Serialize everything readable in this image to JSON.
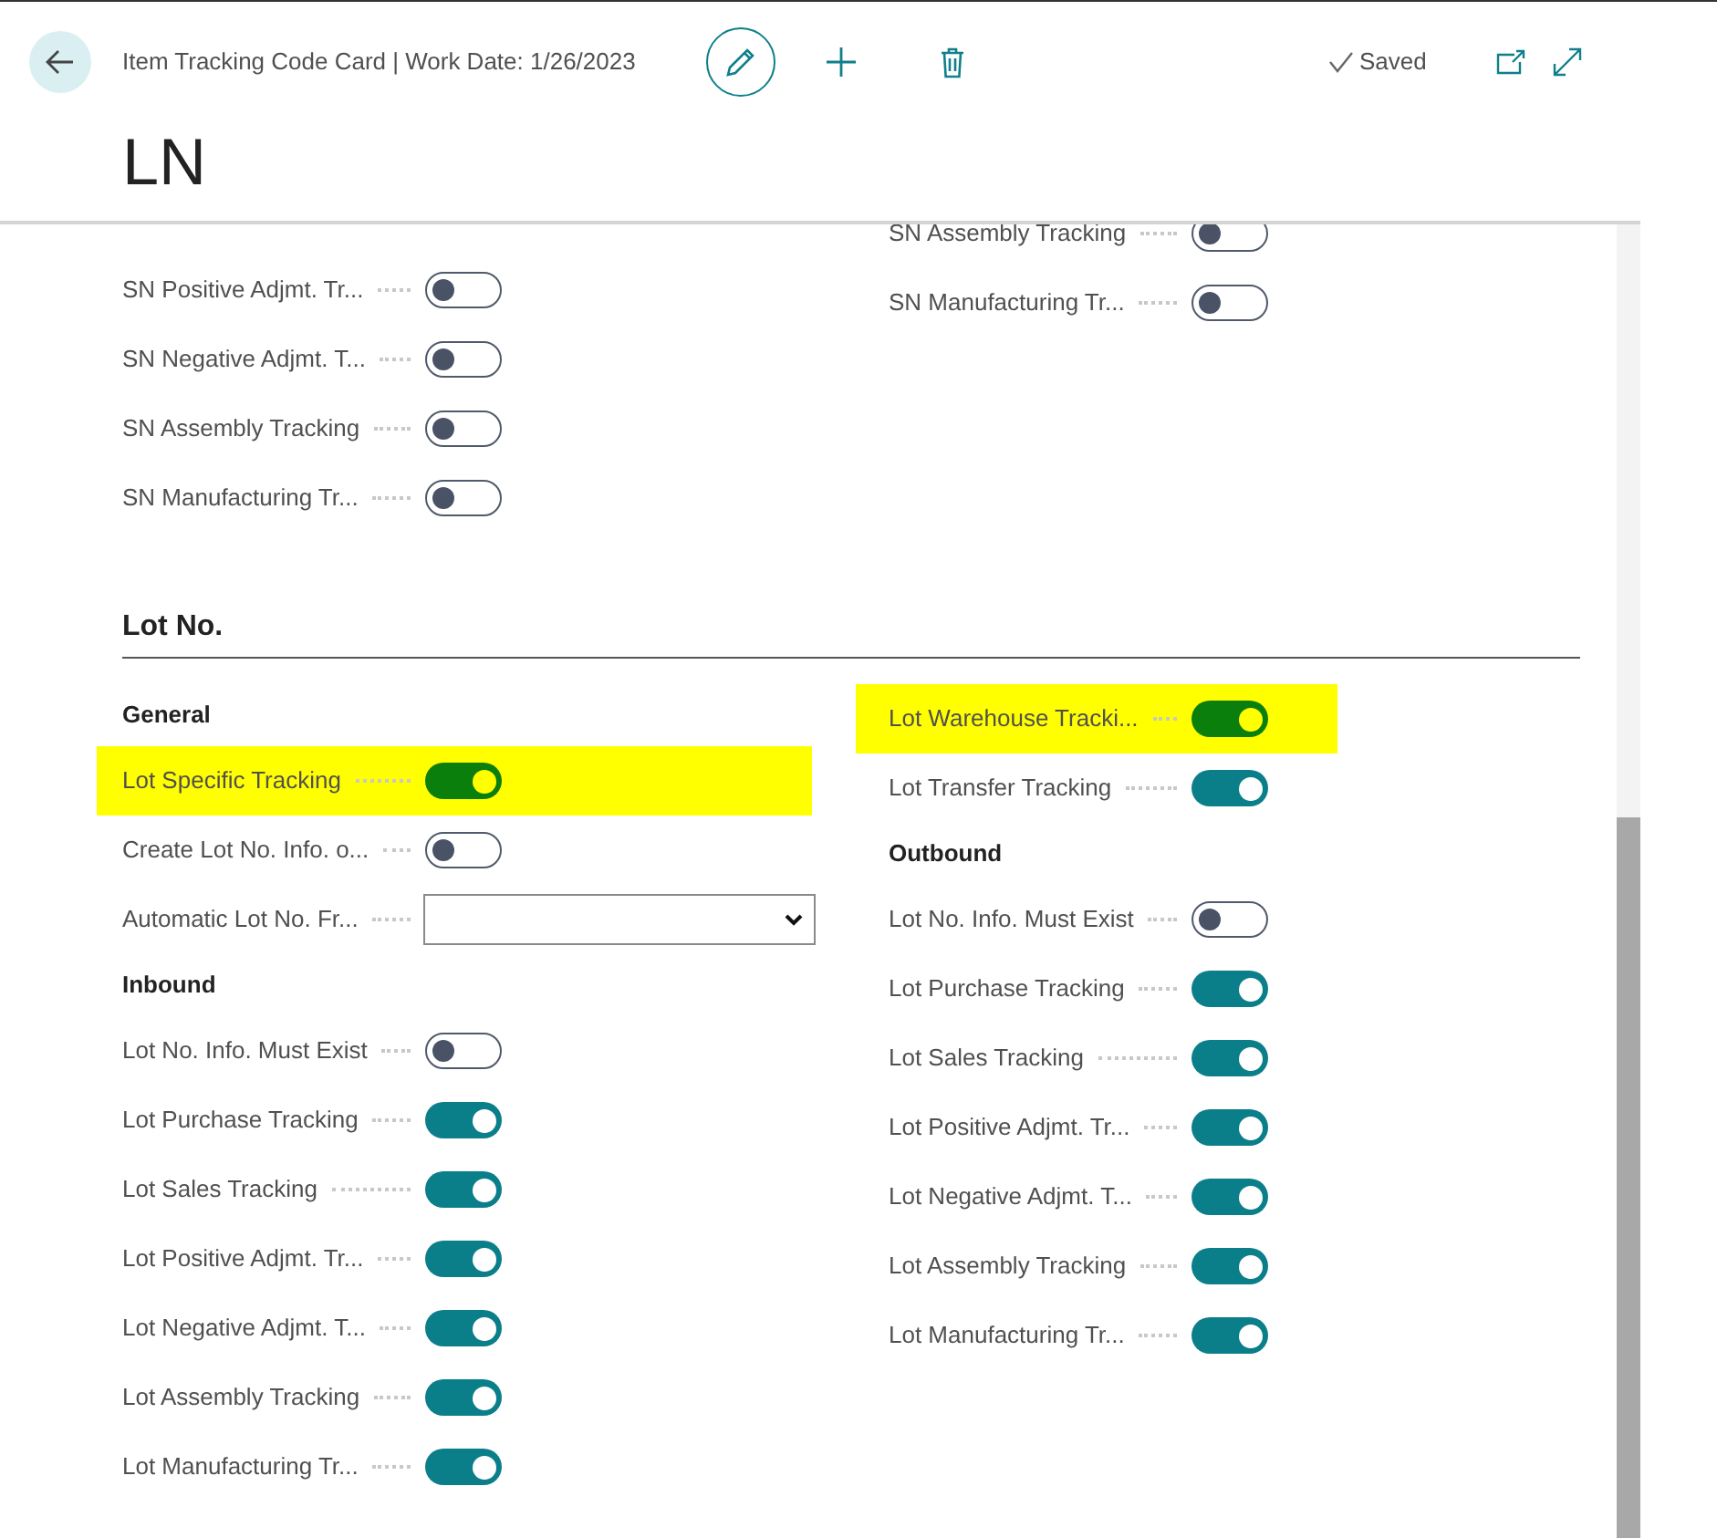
{
  "header": {
    "title": "Item Tracking Code Card | Work Date: 1/26/2023",
    "status": "Saved"
  },
  "record_title": "LN",
  "serial_fields": {
    "left": [
      {
        "kind": "toggle",
        "label": "SN Positive Adjmt. Tr...",
        "on": false,
        "highlighted": false
      },
      {
        "kind": "toggle",
        "label": "SN Negative Adjmt. T...",
        "on": false,
        "highlighted": false
      },
      {
        "kind": "toggle",
        "label": "SN Assembly Tracking",
        "on": false,
        "highlighted": false
      },
      {
        "kind": "toggle",
        "label": "SN Manufacturing Tr...",
        "on": false,
        "highlighted": false
      }
    ],
    "right": [
      {
        "kind": "toggle",
        "label": "SN Assembly Tracking",
        "on": false,
        "highlighted": false
      },
      {
        "kind": "toggle",
        "label": "SN Manufacturing Tr...",
        "on": false,
        "highlighted": false
      }
    ]
  },
  "lot_section": {
    "title": "Lot No.",
    "left": [
      {
        "kind": "group",
        "label": "General"
      },
      {
        "kind": "toggle",
        "label": "Lot Specific Tracking",
        "on": true,
        "highlighted": true
      },
      {
        "kind": "toggle",
        "label": "Create Lot No. Info. o...",
        "on": false,
        "highlighted": false
      },
      {
        "kind": "select",
        "label": "Automatic Lot No. Fr..."
      },
      {
        "kind": "group",
        "label": "Inbound"
      },
      {
        "kind": "toggle",
        "label": "Lot No. Info. Must Exist",
        "on": false,
        "highlighted": false
      },
      {
        "kind": "toggle",
        "label": "Lot Purchase Tracking",
        "on": true,
        "highlighted": false
      },
      {
        "kind": "toggle",
        "label": "Lot Sales Tracking",
        "on": true,
        "highlighted": false
      },
      {
        "kind": "toggle",
        "label": "Lot Positive Adjmt. Tr...",
        "on": true,
        "highlighted": false
      },
      {
        "kind": "toggle",
        "label": "Lot Negative Adjmt. T...",
        "on": true,
        "highlighted": false
      },
      {
        "kind": "toggle",
        "label": "Lot Assembly Tracking",
        "on": true,
        "highlighted": false
      },
      {
        "kind": "toggle",
        "label": "Lot Manufacturing Tr...",
        "on": true,
        "highlighted": false
      }
    ],
    "right": [
      {
        "kind": "toggle",
        "label": "Lot Warehouse Tracki...",
        "on": true,
        "highlighted": true
      },
      {
        "kind": "toggle",
        "label": "Lot Transfer Tracking",
        "on": true,
        "highlighted": false
      },
      {
        "kind": "group",
        "label": "Outbound"
      },
      {
        "kind": "toggle",
        "label": "Lot No. Info. Must Exist",
        "on": false,
        "highlighted": false
      },
      {
        "kind": "toggle",
        "label": "Lot Purchase Tracking",
        "on": true,
        "highlighted": false
      },
      {
        "kind": "toggle",
        "label": "Lot Sales Tracking",
        "on": true,
        "highlighted": false
      },
      {
        "kind": "toggle",
        "label": "Lot Positive Adjmt. Tr...",
        "on": true,
        "highlighted": false
      },
      {
        "kind": "toggle",
        "label": "Lot Negative Adjmt. T...",
        "on": true,
        "highlighted": false
      },
      {
        "kind": "toggle",
        "label": "Lot Assembly Tracking",
        "on": true,
        "highlighted": false
      },
      {
        "kind": "toggle",
        "label": "Lot Manufacturing Tr...",
        "on": true,
        "highlighted": false
      }
    ]
  }
}
